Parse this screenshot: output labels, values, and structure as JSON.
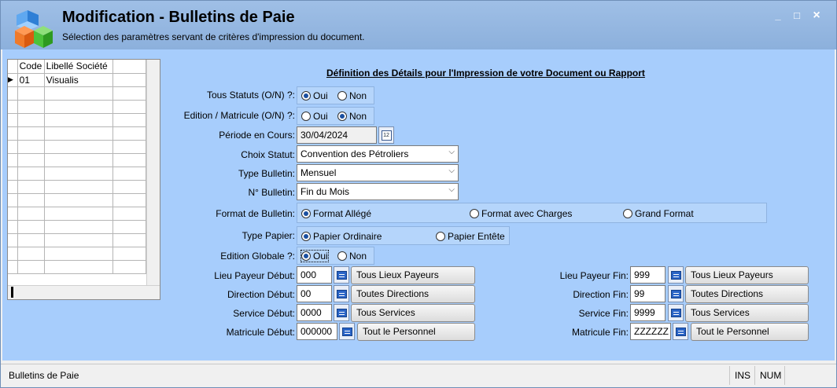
{
  "window": {
    "title": "Modification - Bulletins de Paie",
    "subtitle": "Sélection des paramètres servant de critères d'impression du document.",
    "controls": {
      "minimize": "_",
      "maximize": "□",
      "close": "×"
    }
  },
  "grid": {
    "headers": [
      "Code",
      "Libellé Société"
    ],
    "rows": [
      {
        "code": "01",
        "libelle": "Visualis"
      }
    ]
  },
  "section_title": "Définition des Détails pour l'Impression de votre Document ou Rapport",
  "form": {
    "tous_statuts": {
      "label": "Tous Statuts (O/N) ?:",
      "opt_oui": "Oui",
      "opt_non": "Non",
      "selected": "Oui"
    },
    "edition_matricule": {
      "label": "Edition / Matricule (O/N) ?:",
      "opt_oui": "Oui",
      "opt_non": "Non",
      "selected": "Non"
    },
    "periode": {
      "label": "Période en Cours:",
      "value": "30/04/2024",
      "cal_icon_text": "12"
    },
    "choix_statut": {
      "label": "Choix Statut:",
      "value": "Convention des Pétroliers"
    },
    "type_bulletin": {
      "label": "Type Bulletin:",
      "value": "Mensuel"
    },
    "no_bulletin": {
      "label": "N° Bulletin:",
      "value": "Fin du Mois"
    },
    "format_bulletin": {
      "label": "Format de Bulletin:",
      "opt1": "Format Allégé",
      "opt2": "Format  avec Charges",
      "opt3": "Grand Format",
      "selected": "Format Allégé"
    },
    "type_papier": {
      "label": "Type Papier:",
      "opt1": "Papier Ordinaire",
      "opt2": "Papier Entête",
      "selected": "Papier Ordinaire"
    },
    "edition_globale": {
      "label": "Edition Globale ?:",
      "opt_oui": "Oui",
      "opt_non": "Non",
      "selected": "Oui"
    },
    "lieu_payeur_debut": {
      "label": "Lieu Payeur Début:",
      "value": "000",
      "button": "Tous Lieux Payeurs"
    },
    "direction_debut": {
      "label": "Direction Début:",
      "value": "00",
      "button": "Toutes Directions"
    },
    "service_debut": {
      "label": "Service Début:",
      "value": "0000",
      "button": "Tous Services"
    },
    "matricule_debut": {
      "label": "Matricule Début:",
      "value": "000000",
      "button": "Tout le Personnel"
    },
    "lieu_payeur_fin": {
      "label": "Lieu Payeur Fin:",
      "value": "999",
      "button": "Tous Lieux Payeurs"
    },
    "direction_fin": {
      "label": "Direction Fin:",
      "value": "99",
      "button": "Toutes Directions"
    },
    "service_fin": {
      "label": "Service Fin:",
      "value": "9999",
      "button": "Tous Services"
    },
    "matricule_fin": {
      "label": "Matricule Fin:",
      "value": "ZZZZZZ",
      "button": "Tout le Personnel"
    }
  },
  "statusbar": {
    "text": "Bulletins de Paie",
    "ins": "INS",
    "num": "NUM"
  }
}
